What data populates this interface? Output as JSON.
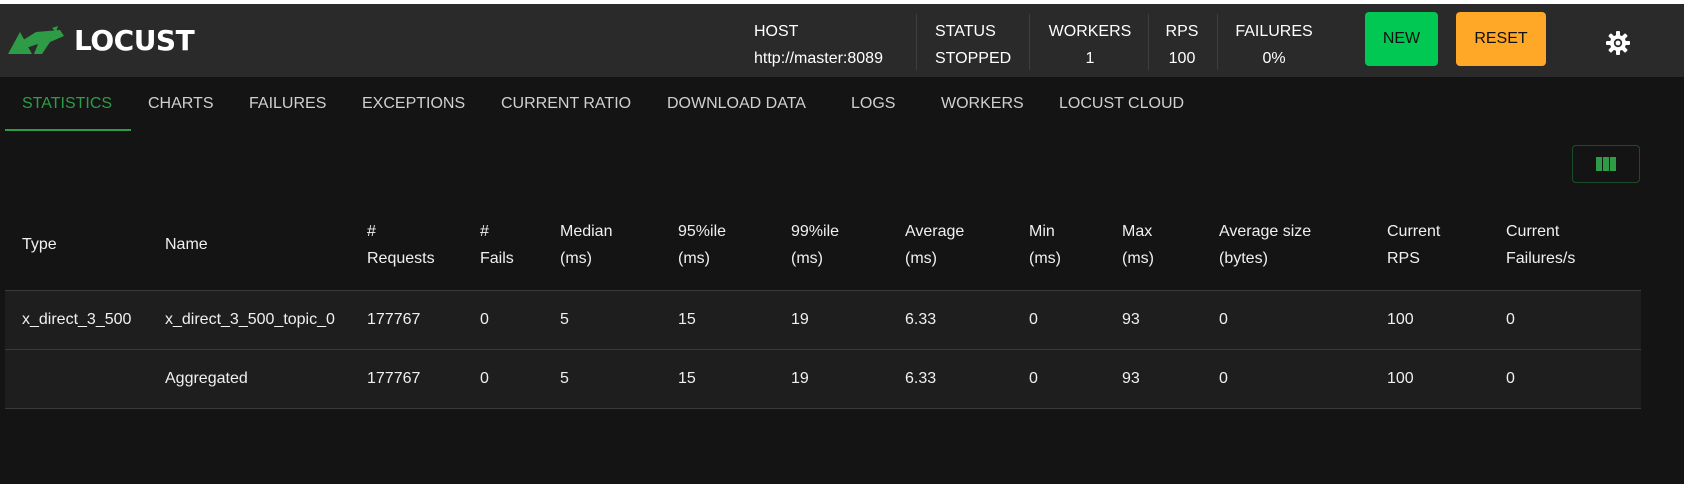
{
  "brand": {
    "name": "LOCUST"
  },
  "header": {
    "host": {
      "label": "HOST",
      "value": "http://master:8089"
    },
    "status": {
      "label": "STATUS",
      "value": "STOPPED"
    },
    "workers": {
      "label": "WORKERS",
      "value": "1"
    },
    "rps": {
      "label": "RPS",
      "value": "100"
    },
    "failures": {
      "label": "FAILURES",
      "value": "0%"
    },
    "new_label": "NEW",
    "reset_label": "RESET"
  },
  "tabs": [
    {
      "label": "STATISTICS",
      "active": true
    },
    {
      "label": "CHARTS"
    },
    {
      "label": "FAILURES"
    },
    {
      "label": "EXCEPTIONS"
    },
    {
      "label": "CURRENT RATIO"
    },
    {
      "label": "DOWNLOAD DATA"
    },
    {
      "label": "LOGS"
    },
    {
      "label": "WORKERS"
    },
    {
      "label": "LOCUST CLOUD"
    }
  ],
  "colors": {
    "accent": "#2e9c46",
    "new_button": "#00c853",
    "reset_button": "#ffa726",
    "header_bg": "#2a2a2a",
    "page_bg": "#141414"
  },
  "table": {
    "columns": [
      {
        "line1": "Type",
        "line2": ""
      },
      {
        "line1": "Name",
        "line2": ""
      },
      {
        "line1": "#",
        "line2": "Requests"
      },
      {
        "line1": "#",
        "line2": "Fails"
      },
      {
        "line1": "Median",
        "line2": "(ms)"
      },
      {
        "line1": "95%ile",
        "line2": "(ms)"
      },
      {
        "line1": "99%ile",
        "line2": "(ms)"
      },
      {
        "line1": "Average",
        "line2": "(ms)"
      },
      {
        "line1": "Min",
        "line2": "(ms)"
      },
      {
        "line1": "Max",
        "line2": "(ms)"
      },
      {
        "line1": "Average size",
        "line2": "(bytes)"
      },
      {
        "line1": "Current",
        "line2": "RPS"
      },
      {
        "line1": "Current",
        "line2": "Failures/s"
      }
    ],
    "rows": [
      [
        "x_direct_3_500",
        "x_direct_3_500_topic_0",
        "177767",
        "0",
        "5",
        "15",
        "19",
        "6.33",
        "0",
        "93",
        "0",
        "100",
        "0"
      ],
      [
        "",
        "Aggregated",
        "177767",
        "0",
        "5",
        "15",
        "19",
        "6.33",
        "0",
        "93",
        "0",
        "100",
        "0"
      ]
    ]
  }
}
